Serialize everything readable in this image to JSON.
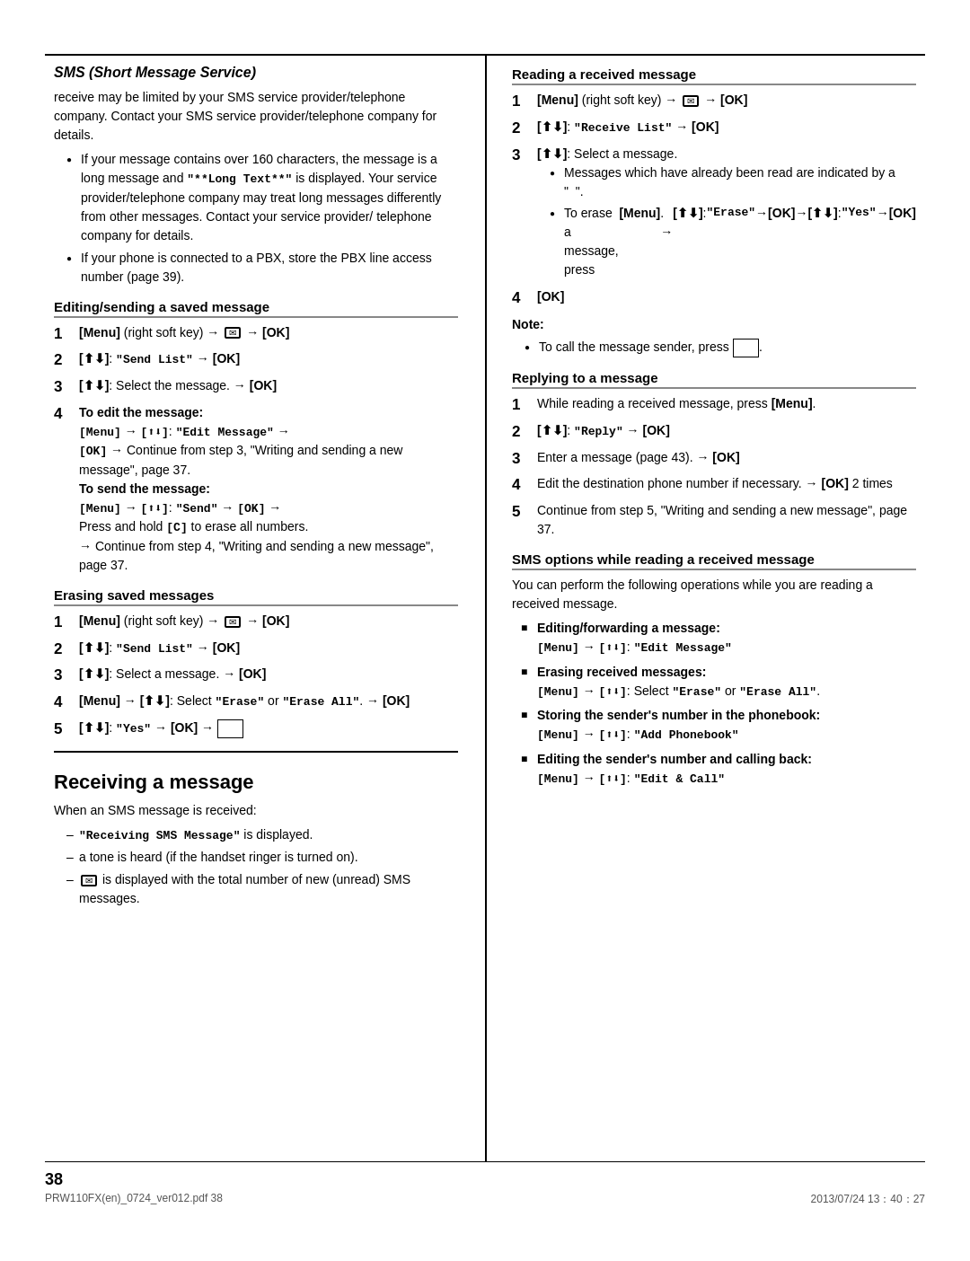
{
  "page": {
    "title": "SMS (Short Message Service)",
    "page_number": "38",
    "footer_left": "PRW110FX(en)_0724_ver012.pdf    38",
    "footer_right": "2013/07/24   13：40：27"
  },
  "left_column": {
    "section_title": "SMS (Short Message Service)",
    "intro_paragraphs": [
      "receive may be limited by your SMS service provider/telephone company. Contact your SMS service provider/telephone company for details."
    ],
    "bullets": [
      "If your message contains over 160 characters, the message is a long message and \"**Long Text**\" is displayed. Your service provider/telephone company may treat long messages differently from other messages. Contact your service provider/ telephone company for details.",
      "If your phone is connected to a PBX, store the PBX line access number (page 39)."
    ],
    "editing_section": {
      "heading": "Editing/sending a saved message",
      "steps": [
        {
          "num": "1",
          "text": "[Menu] (right soft key) → ✉ → [OK]"
        },
        {
          "num": "2",
          "text": "[⬆⬇]: \"Send List\" → [OK]"
        },
        {
          "num": "3",
          "text": "[⬆⬇]: Select the message. → [OK]"
        },
        {
          "num": "4",
          "text_parts": [
            {
              "label": "To edit the message:",
              "bold": true
            },
            "[Menu] → [⬆⬇]: \"Edit Message\" → [OK] → Continue from step 3, \"Writing and sending a new message\", page 37.",
            {
              "label": "To send the message:",
              "bold": true
            },
            "[Menu] → [⬆⬇]: \"Send\" → [OK] → Press and hold [C] to erase all numbers. → Continue from step 4, \"Writing and sending a new message\", page 37."
          ]
        }
      ]
    },
    "erasing_section": {
      "heading": "Erasing saved messages",
      "steps": [
        {
          "num": "1",
          "text": "[Menu] (right soft key) → ✉ → [OK]"
        },
        {
          "num": "2",
          "text": "[⬆⬇]: \"Send List\" → [OK]"
        },
        {
          "num": "3",
          "text": "[⬆⬇]: Select a message. → [OK]"
        },
        {
          "num": "4",
          "text": "[Menu] → [⬆⬇]: Select \"Erase\" or \"Erase All\". → [OK]"
        },
        {
          "num": "5",
          "text": "[⬆⬇]: \"Yes\" → [OK] → [  ]"
        }
      ]
    },
    "receiving_section": {
      "heading": "Receiving a message",
      "intro": "When an SMS message is received:",
      "dash_items": [
        "\"Receiving SMS Message\" is displayed.",
        "a tone is heard (if the handset ringer is turned on).",
        "✉ is displayed with the total number of new (unread) SMS messages."
      ]
    }
  },
  "right_column": {
    "reading_section": {
      "heading": "Reading a received message",
      "steps": [
        {
          "num": "1",
          "text": "[Menu] (right soft key) → ✉ → [OK]"
        },
        {
          "num": "2",
          "text": "[⬆⬇]: \"Receive List\" → [OK]"
        },
        {
          "num": "3",
          "text": "[⬆⬇]: Select a message.",
          "sub_bullets": [
            "Messages which have already been read are indicated by a \"  \".",
            "To erase a message, press [Menu]. → [⬆⬇]: \"Erase\" → [OK] → [⬆⬇]: \"Yes\" → [OK]"
          ]
        },
        {
          "num": "4",
          "text": "[OK]"
        }
      ],
      "note": {
        "label": "Note:",
        "text": "To call the message sender, press [    ]."
      }
    },
    "replying_section": {
      "heading": "Replying to a message",
      "steps": [
        {
          "num": "1",
          "text": "While reading a received message, press [Menu]."
        },
        {
          "num": "2",
          "text": "[⬆⬇]: \"Reply\" → [OK]"
        },
        {
          "num": "3",
          "text": "Enter a message (page 43). → [OK]"
        },
        {
          "num": "4",
          "text": "Edit the destination phone number if necessary. → [OK] 2 times"
        },
        {
          "num": "5",
          "text": "Continue from step 5, \"Writing and sending a new message\", page 37."
        }
      ]
    },
    "sms_options_section": {
      "heading": "SMS options while reading a received message",
      "intro": "You can perform the following operations while you are reading a received message.",
      "square_items": [
        {
          "bold_text": "Editing/forwarding a message:",
          "rest": "[Menu] → [⬆⬇]: \"Edit Message\""
        },
        {
          "bold_text": "Erasing received messages:",
          "rest": "[Menu] → [⬆⬇]: Select \"Erase\" or \"Erase All\"."
        },
        {
          "bold_text": "Storing the sender's number in the phonebook:",
          "rest": "[Menu] → [⬆⬇]: \"Add Phonebook\""
        },
        {
          "bold_text": "Editing the sender's number and calling back:",
          "rest": "[Menu] → [⬆⬇]: \"Edit & Call\""
        }
      ]
    }
  }
}
